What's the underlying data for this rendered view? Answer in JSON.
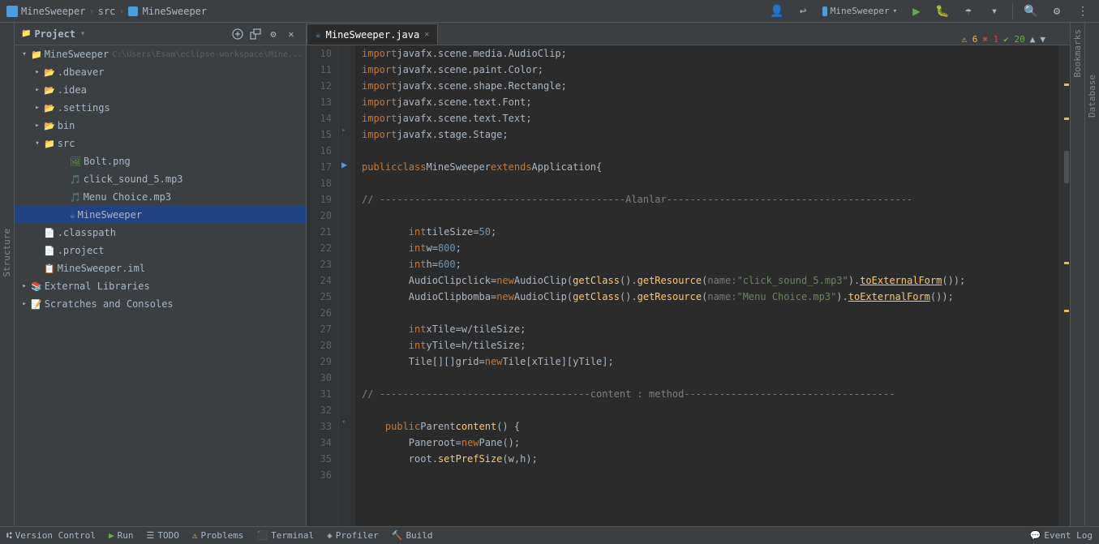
{
  "titlebar": {
    "project_name": "MineSweeper",
    "sep1": "›",
    "src": "src",
    "sep2": "›",
    "file": "MineSweeper",
    "run_config": "MineSweeper",
    "buttons": {
      "profile": "👤",
      "vcs": "↩",
      "run": "▶",
      "debug": "🐛",
      "coverage": "☂",
      "search": "🔍",
      "settings": "⚙"
    }
  },
  "sidebar": {
    "title": "Project",
    "tree": [
      {
        "id": "minesweeper-root",
        "label": "MineSweeper",
        "path": "C:\\Users\\Esam\\eclipse-workspace\\Mine...",
        "type": "project",
        "expanded": true,
        "level": 0
      },
      {
        "id": "dbeaver",
        "label": ".dbeaver",
        "type": "folder",
        "expanded": false,
        "level": 1
      },
      {
        "id": "idea",
        "label": ".idea",
        "type": "folder",
        "expanded": false,
        "level": 1
      },
      {
        "id": "settings",
        "label": ".settings",
        "type": "folder",
        "expanded": false,
        "level": 1
      },
      {
        "id": "bin",
        "label": "bin",
        "type": "folder",
        "expanded": false,
        "level": 1
      },
      {
        "id": "src",
        "label": "src",
        "type": "src-folder",
        "expanded": true,
        "level": 1
      },
      {
        "id": "bolt",
        "label": "Bolt.png",
        "type": "png",
        "level": 2
      },
      {
        "id": "click",
        "label": "click_sound_5.mp3",
        "type": "mp3",
        "level": 2
      },
      {
        "id": "menu",
        "label": "Menu Choice.mp3",
        "type": "mp3",
        "level": 2
      },
      {
        "id": "minesweeper-file",
        "label": "MineSweeper",
        "type": "java",
        "level": 2,
        "selected": true
      },
      {
        "id": "classpath",
        "label": ".classpath",
        "type": "xml",
        "level": 1
      },
      {
        "id": "project",
        "label": ".project",
        "type": "xml",
        "level": 1
      },
      {
        "id": "iml",
        "label": "MineSweeper.iml",
        "type": "iml",
        "level": 1
      },
      {
        "id": "ext-libs",
        "label": "External Libraries",
        "type": "folder",
        "expanded": false,
        "level": 0
      },
      {
        "id": "scratches",
        "label": "Scratches and Consoles",
        "type": "folder",
        "expanded": false,
        "level": 0
      }
    ]
  },
  "editor": {
    "tab_label": "MineSweeper.java",
    "indicators": {
      "warnings": "⚠ 6",
      "errors": "✖ 1",
      "ok": "✔ 20"
    },
    "lines": [
      {
        "num": 10,
        "tokens": [
          {
            "t": "import ",
            "c": "kw"
          },
          {
            "t": "javafx.scene.media.AudioClip",
            "c": "pkg"
          },
          {
            "t": ";",
            "c": "op"
          }
        ]
      },
      {
        "num": 11,
        "tokens": [
          {
            "t": "import ",
            "c": "kw"
          },
          {
            "t": "javafx.scene.paint.Color",
            "c": "pkg"
          },
          {
            "t": ";",
            "c": "op"
          }
        ]
      },
      {
        "num": 12,
        "tokens": [
          {
            "t": "import ",
            "c": "kw"
          },
          {
            "t": "javafx.scene.shape.Rectangle",
            "c": "pkg"
          },
          {
            "t": ";",
            "c": "op"
          }
        ]
      },
      {
        "num": 13,
        "tokens": [
          {
            "t": "import ",
            "c": "kw"
          },
          {
            "t": "javafx.scene.text.Font",
            "c": "pkg"
          },
          {
            "t": ";",
            "c": "op"
          }
        ]
      },
      {
        "num": 14,
        "tokens": [
          {
            "t": "import ",
            "c": "kw"
          },
          {
            "t": "javafx.scene.text.Text",
            "c": "pkg"
          },
          {
            "t": ";",
            "c": "op"
          }
        ]
      },
      {
        "num": 15,
        "tokens": [
          {
            "t": "import ",
            "c": "kw"
          },
          {
            "t": "javafx.stage.Stage",
            "c": "pkg"
          },
          {
            "t": ";",
            "c": "op"
          }
        ],
        "fold": true
      },
      {
        "num": 16,
        "tokens": []
      },
      {
        "num": 17,
        "tokens": [
          {
            "t": "public ",
            "c": "kw"
          },
          {
            "t": "class ",
            "c": "kw"
          },
          {
            "t": "MineSweeper ",
            "c": "cls"
          },
          {
            "t": "extends ",
            "c": "kw"
          },
          {
            "t": "Application",
            "c": "cls"
          },
          {
            "t": " {",
            "c": "op"
          }
        ],
        "play": true
      },
      {
        "num": 18,
        "tokens": []
      },
      {
        "num": 19,
        "tokens": [
          {
            "t": "    // ",
            "c": "cmt"
          },
          {
            "t": "------------------------------------------Alanlar------------------------------------------",
            "c": "cmt"
          }
        ]
      },
      {
        "num": 20,
        "tokens": []
      },
      {
        "num": 21,
        "tokens": [
          {
            "t": "        ",
            "c": ""
          },
          {
            "t": "int ",
            "c": "kw"
          },
          {
            "t": "tileSize",
            "c": "var"
          },
          {
            "t": " = ",
            "c": "op"
          },
          {
            "t": "50",
            "c": "num"
          },
          {
            "t": ";",
            "c": "op"
          }
        ]
      },
      {
        "num": 22,
        "tokens": [
          {
            "t": "        ",
            "c": ""
          },
          {
            "t": "int ",
            "c": "kw"
          },
          {
            "t": "w",
            "c": "var"
          },
          {
            "t": " = ",
            "c": "op"
          },
          {
            "t": "800",
            "c": "num"
          },
          {
            "t": ";",
            "c": "op"
          }
        ]
      },
      {
        "num": 23,
        "tokens": [
          {
            "t": "        ",
            "c": ""
          },
          {
            "t": "int ",
            "c": "kw"
          },
          {
            "t": "h",
            "c": "var"
          },
          {
            "t": " = ",
            "c": "op"
          },
          {
            "t": "600",
            "c": "num"
          },
          {
            "t": ";",
            "c": "op"
          }
        ]
      },
      {
        "num": 24,
        "tokens": [
          {
            "t": "        ",
            "c": ""
          },
          {
            "t": "AudioClip ",
            "c": "type"
          },
          {
            "t": "click",
            "c": "var"
          },
          {
            "t": " = ",
            "c": "op"
          },
          {
            "t": "new ",
            "c": "kw"
          },
          {
            "t": "AudioClip",
            "c": "cls"
          },
          {
            "t": "(",
            "c": "op"
          },
          {
            "t": "getClass",
            "c": "fn"
          },
          {
            "t": "().",
            "c": "op"
          },
          {
            "t": "getResource",
            "c": "fn"
          },
          {
            "t": "(",
            "c": "op"
          },
          {
            "t": "name: ",
            "c": "hint"
          },
          {
            "t": "\"click_sound_5.mp3\"",
            "c": "str"
          },
          {
            "t": ").",
            "c": "op"
          },
          {
            "t": "toExternalForm",
            "c": "bold-method"
          },
          {
            "t": "());",
            "c": "op"
          }
        ]
      },
      {
        "num": 25,
        "tokens": [
          {
            "t": "        ",
            "c": ""
          },
          {
            "t": "AudioClip ",
            "c": "type"
          },
          {
            "t": "bomba",
            "c": "var"
          },
          {
            "t": " = ",
            "c": "op"
          },
          {
            "t": "new ",
            "c": "kw"
          },
          {
            "t": "AudioClip",
            "c": "cls"
          },
          {
            "t": "(",
            "c": "op"
          },
          {
            "t": "getClass",
            "c": "fn"
          },
          {
            "t": "().",
            "c": "op"
          },
          {
            "t": "getResource",
            "c": "fn"
          },
          {
            "t": "(",
            "c": "op"
          },
          {
            "t": "name: ",
            "c": "hint"
          },
          {
            "t": "\"Menu Choice.mp3\"",
            "c": "str"
          },
          {
            "t": ").",
            "c": "op"
          },
          {
            "t": "toExternalForm",
            "c": "bold-method"
          },
          {
            "t": "());",
            "c": "op"
          }
        ]
      },
      {
        "num": 26,
        "tokens": []
      },
      {
        "num": 27,
        "tokens": [
          {
            "t": "        ",
            "c": ""
          },
          {
            "t": "int ",
            "c": "kw"
          },
          {
            "t": "xTile",
            "c": "var"
          },
          {
            "t": " = ",
            "c": "op"
          },
          {
            "t": "w",
            "c": "var"
          },
          {
            "t": " / ",
            "c": "op"
          },
          {
            "t": "tileSize",
            "c": "var"
          },
          {
            "t": ";",
            "c": "op"
          }
        ]
      },
      {
        "num": 28,
        "tokens": [
          {
            "t": "        ",
            "c": ""
          },
          {
            "t": "int ",
            "c": "kw"
          },
          {
            "t": "yTile",
            "c": "var"
          },
          {
            "t": " = ",
            "c": "op"
          },
          {
            "t": "h",
            "c": "var"
          },
          {
            "t": " / ",
            "c": "op"
          },
          {
            "t": "tileSize",
            "c": "var"
          },
          {
            "t": ";",
            "c": "op"
          }
        ]
      },
      {
        "num": 29,
        "tokens": [
          {
            "t": "        ",
            "c": ""
          },
          {
            "t": "Tile",
            "c": "cls"
          },
          {
            "t": "[][] ",
            "c": "op"
          },
          {
            "t": "grid",
            "c": "var"
          },
          {
            "t": " = ",
            "c": "op"
          },
          {
            "t": "new ",
            "c": "kw"
          },
          {
            "t": "Tile",
            "c": "cls"
          },
          {
            "t": "[",
            "c": "op"
          },
          {
            "t": "xTile",
            "c": "var"
          },
          {
            "t": "][",
            "c": "op"
          },
          {
            "t": "yTile",
            "c": "var"
          },
          {
            "t": "];",
            "c": "op"
          }
        ]
      },
      {
        "num": 30,
        "tokens": []
      },
      {
        "num": 31,
        "tokens": [
          {
            "t": "    // ",
            "c": "cmt"
          },
          {
            "t": "------------------------------------content : method------------------------------------",
            "c": "cmt"
          }
        ]
      },
      {
        "num": 32,
        "tokens": []
      },
      {
        "num": 33,
        "tokens": [
          {
            "t": "    ",
            "c": ""
          },
          {
            "t": "public ",
            "c": "kw"
          },
          {
            "t": "Parent ",
            "c": "type"
          },
          {
            "t": "content",
            "c": "fn"
          },
          {
            "t": "() {",
            "c": "op"
          }
        ],
        "fold": true
      },
      {
        "num": 34,
        "tokens": [
          {
            "t": "        ",
            "c": ""
          },
          {
            "t": "Pane ",
            "c": "type"
          },
          {
            "t": "root",
            "c": "var"
          },
          {
            "t": " = ",
            "c": "op"
          },
          {
            "t": "new ",
            "c": "kw"
          },
          {
            "t": "Pane",
            "c": "cls"
          },
          {
            "t": "();",
            "c": "op"
          }
        ]
      },
      {
        "num": 35,
        "tokens": [
          {
            "t": "        ",
            "c": ""
          },
          {
            "t": "root",
            "c": "var"
          },
          {
            "t": ".",
            "c": "op"
          },
          {
            "t": "setPrefSize",
            "c": "fn"
          },
          {
            "t": "(",
            "c": "op"
          },
          {
            "t": "w",
            "c": "var"
          },
          {
            "t": ", ",
            "c": "op"
          },
          {
            "t": "h",
            "c": "var"
          },
          {
            "t": ");",
            "c": "op"
          }
        ]
      },
      {
        "num": 36,
        "tokens": []
      }
    ]
  },
  "status_bar": {
    "version_control": "Version Control",
    "run": "Run",
    "todo": "TODO",
    "problems": "Problems",
    "terminal": "Terminal",
    "profiler": "Profiler",
    "build": "Build",
    "event_log": "Event Log"
  },
  "colors": {
    "accent": "#4a9edd",
    "warning": "#e8b85e",
    "error": "#cc4444",
    "ok": "#6aa84f",
    "selected": "#214283"
  }
}
